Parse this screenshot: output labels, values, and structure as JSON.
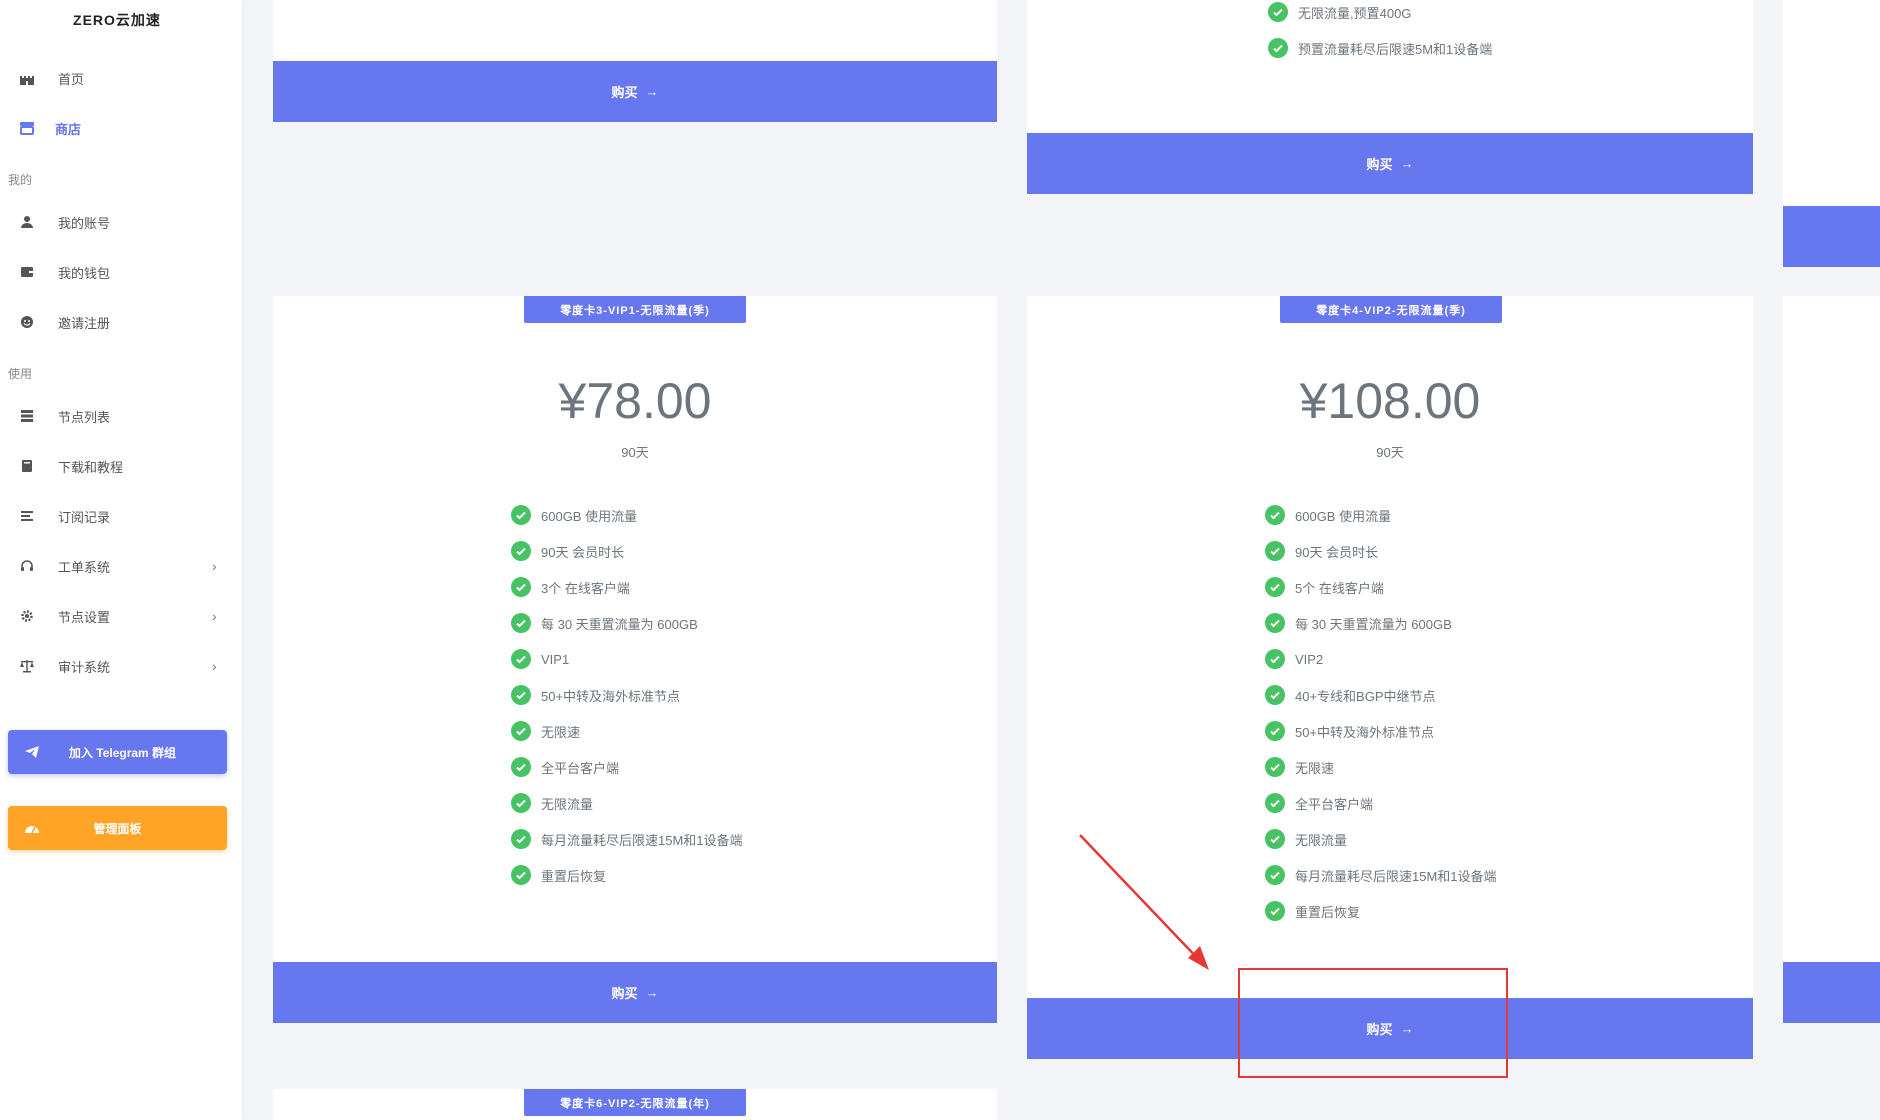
{
  "sidebar": {
    "brand": "ZERO云加速",
    "items": [
      {
        "label": "首页",
        "icon": "castle-icon"
      },
      {
        "label": "商店",
        "icon": "store-icon"
      },
      {
        "label": "我的账号",
        "icon": "user-icon"
      },
      {
        "label": "我的钱包",
        "icon": "wallet-icon"
      },
      {
        "label": "邀请注册",
        "icon": "smile-icon"
      },
      {
        "label": "节点列表",
        "icon": "server-icon"
      },
      {
        "label": "下载和教程",
        "icon": "book-icon"
      },
      {
        "label": "订阅记录",
        "icon": "list-icon"
      },
      {
        "label": "工单系统",
        "icon": "headset-icon"
      },
      {
        "label": "节点设置",
        "icon": "gear-icon"
      },
      {
        "label": "审计系统",
        "icon": "scale-icon"
      }
    ],
    "sections": [
      "我的",
      "使用"
    ],
    "telegram_button": "加入 Telegram 群组",
    "admin_button": "管理面板"
  },
  "colors": {
    "accent": "#6777ef",
    "check": "#47c363",
    "warning": "#ffa426",
    "highlight": "#e53935"
  },
  "buy_label": "购买",
  "top_card": {
    "features": [
      "无限流量,预置400G",
      "预置流量耗尽后限速5M和1设备端"
    ]
  },
  "cards": [
    {
      "badge": "零度卡3-VIP1-无限流量(季)",
      "price": "¥78.00",
      "period": "90天",
      "features": [
        "600GB 使用流量",
        "90天 会员时长",
        "3个 在线客户端",
        "每 30 天重置流量为 600GB",
        "VIP1",
        "50+中转及海外标准节点",
        "无限速",
        "全平台客户端",
        "无限流量",
        "每月流量耗尽后限速15M和1设备端",
        "重置后恢复"
      ]
    },
    {
      "badge": "零度卡4-VIP2-无限流量(季)",
      "price": "¥108.00",
      "period": "90天",
      "features": [
        "600GB 使用流量",
        "90天 会员时长",
        "5个 在线客户端",
        "每 30 天重置流量为 600GB",
        "VIP2",
        "40+专线和BGP中继节点",
        "50+中转及海外标准节点",
        "无限速",
        "全平台客户端",
        "无限流量",
        "每月流量耗尽后限速15M和1设备端",
        "重置后恢复"
      ]
    }
  ],
  "bottom_badge": "零度卡6-VIP2-无限流量(年)"
}
